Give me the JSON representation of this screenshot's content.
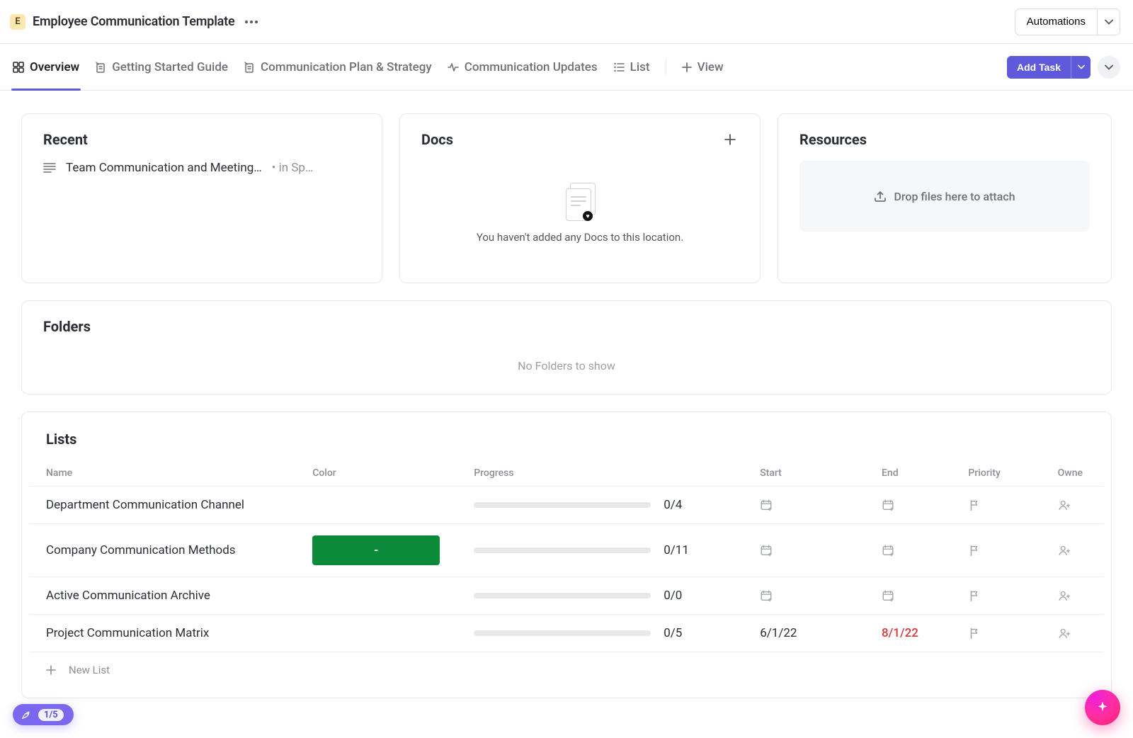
{
  "header": {
    "avatar_letter": "E",
    "title": "Employee Communication Template",
    "automations_label": "Automations"
  },
  "tabs": {
    "overview": "Overview",
    "getting_started": "Getting Started Guide",
    "plan_strategy": "Communication Plan & Strategy",
    "updates": "Communication Updates",
    "list": "List",
    "view": "View",
    "add_task": "Add Task"
  },
  "cards": {
    "recent_title": "Recent",
    "recent_item_name": "Team Communication and Meeting…",
    "recent_item_meta": "• in Sp…",
    "docs_title": "Docs",
    "docs_empty": "You haven't added any Docs to this location.",
    "resources_title": "Resources",
    "dropzone_text": "Drop files here to attach"
  },
  "folders": {
    "title": "Folders",
    "empty_text": "No Folders to show"
  },
  "lists": {
    "title": "Lists",
    "columns": {
      "name": "Name",
      "color": "Color",
      "progress": "Progress",
      "start": "Start",
      "end": "End",
      "priority": "Priority",
      "owner": "Owne"
    },
    "rows": [
      {
        "name": "Department Communication Channel",
        "color": "",
        "progress": "0/4",
        "start": "",
        "end": "",
        "end_overdue": false
      },
      {
        "name": "Company Communication Methods",
        "color": "green",
        "color_label": "-",
        "progress": "0/11",
        "start": "",
        "end": "",
        "end_overdue": false
      },
      {
        "name": "Active Communication Archive",
        "color": "",
        "progress": "0/0",
        "start": "",
        "end": "",
        "end_overdue": false
      },
      {
        "name": "Project Communication Matrix",
        "color": "",
        "progress": "0/5",
        "start": "6/1/22",
        "end": "8/1/22",
        "end_overdue": true
      }
    ],
    "new_list_label": "New List"
  },
  "progress_pill": "1/5"
}
